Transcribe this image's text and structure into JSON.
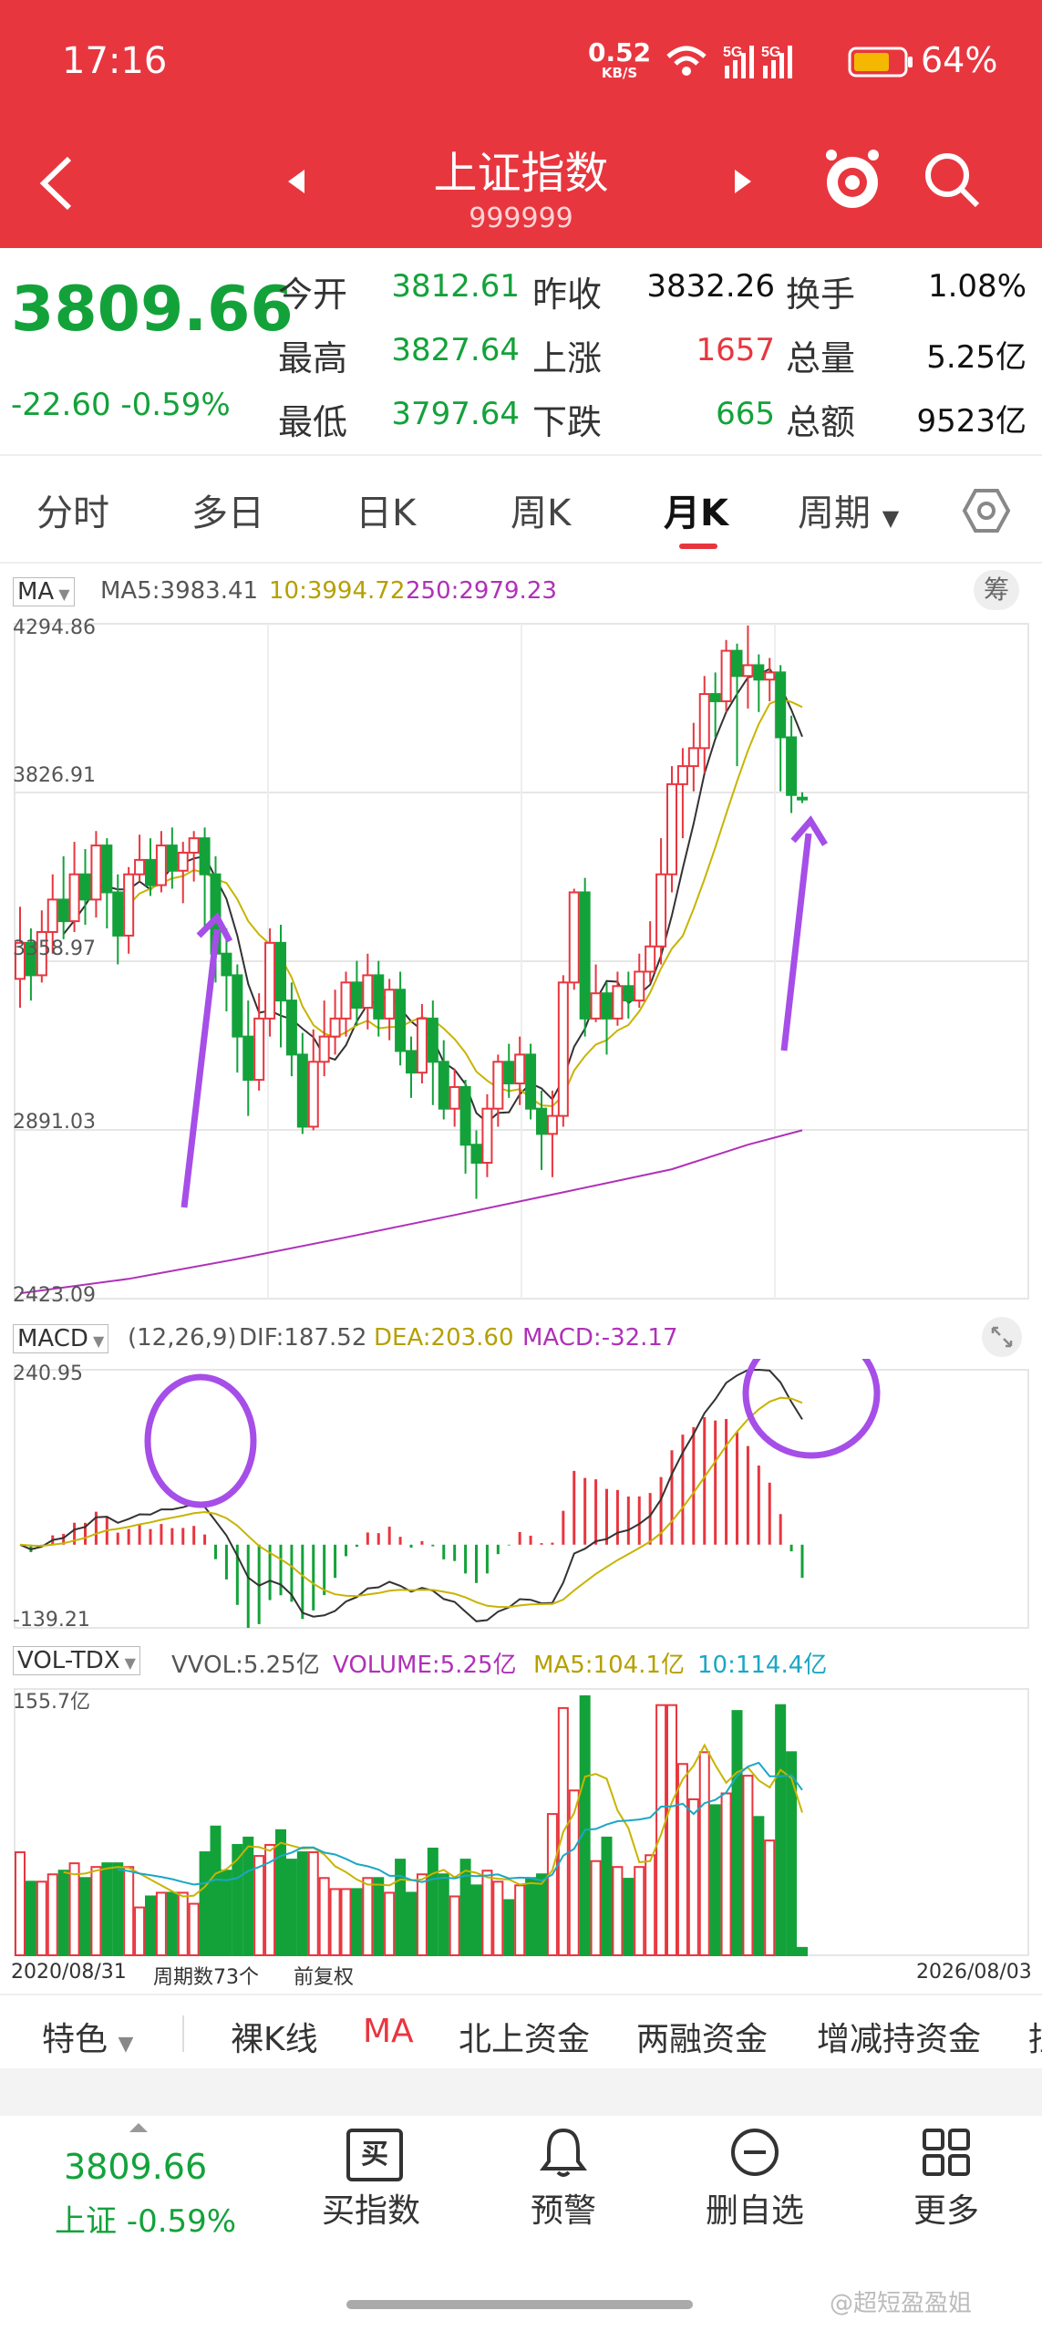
{
  "status_bar": {
    "time": "17:16",
    "net_speed": "0.52",
    "net_unit": "KB/S",
    "battery": "64%"
  },
  "header": {
    "title": "上证指数",
    "code": "999999"
  },
  "quote": {
    "price": "3809.66",
    "change": "-22.60 -0.59%",
    "labels": [
      "今开",
      "最高",
      "最低",
      "昨收",
      "上涨",
      "下跌",
      "换手",
      "总量",
      "总额"
    ],
    "values": [
      "3812.61",
      "3827.64",
      "3797.64",
      "3832.26",
      "1657",
      "665",
      "1.08%",
      "5.25亿",
      "9523亿"
    ]
  },
  "tabs": [
    "分时",
    "多日",
    "日K",
    "周K",
    "月K",
    "周期"
  ],
  "main_chart": {
    "ma_selector": "MA",
    "ma5": "MA5:3983.41",
    "ma10": "10:3994.72",
    "ma250": "250:2979.23",
    "chip_label": "筹",
    "y_labels": [
      "4294.86",
      "3826.91",
      "3358.97",
      "2891.03",
      "2423.09"
    ]
  },
  "macd_panel": {
    "selector": "MACD",
    "params": "(12,26,9)",
    "dif": "DIF:187.52",
    "dea": "DEA:203.60",
    "macd": "MACD:-32.17",
    "y_top": "240.95",
    "y_bottom": "-139.21"
  },
  "vol_panel": {
    "selector": "VOL-TDX",
    "vvol": "VVOL:5.25亿",
    "volume": "VOLUME:5.25亿",
    "ma5": "MA5:104.1亿",
    "ma10": "10:114.4亿",
    "y_top": "155.7亿"
  },
  "footer_axis": {
    "start": "2020/08/31",
    "count": "周期数73个",
    "adj": "前复权",
    "end": "2026/08/03"
  },
  "feature_bar": {
    "items": [
      "特色",
      "裸K线",
      "MA",
      "北上资金",
      "两融资金",
      "增减持资金",
      "拄"
    ]
  },
  "bottom_bar": {
    "price": "3809.66",
    "sub": "上证 -0.59%",
    "buttons": [
      "买指数",
      "预警",
      "删自选",
      "更多"
    ],
    "buy_glyph": "买"
  },
  "watermark": "@超短盈盈姐",
  "chart_data": {
    "type": "candlestick",
    "ylim": [
      2423.09,
      4294.86
    ],
    "candles": [
      [
        3310,
        3410,
        3510,
        3230
      ],
      [
        3410,
        3320,
        3450,
        3250
      ],
      [
        3320,
        3440,
        3500,
        3300
      ],
      [
        3440,
        3530,
        3600,
        3380
      ],
      [
        3530,
        3470,
        3650,
        3420
      ],
      [
        3470,
        3600,
        3690,
        3440
      ],
      [
        3600,
        3530,
        3670,
        3460
      ],
      [
        3530,
        3680,
        3720,
        3480
      ],
      [
        3680,
        3550,
        3700,
        3450
      ],
      [
        3550,
        3430,
        3600,
        3350
      ],
      [
        3430,
        3600,
        3620,
        3380
      ],
      [
        3600,
        3640,
        3710,
        3580
      ],
      [
        3640,
        3570,
        3700,
        3540
      ],
      [
        3570,
        3680,
        3720,
        3550
      ],
      [
        3680,
        3610,
        3730,
        3560
      ],
      [
        3610,
        3660,
        3690,
        3520
      ],
      [
        3660,
        3700,
        3720,
        3580
      ],
      [
        3700,
        3600,
        3730,
        3450
      ],
      [
        3600,
        3380,
        3650,
        3300
      ],
      [
        3380,
        3320,
        3450,
        3220
      ],
      [
        3320,
        3150,
        3350,
        3050
      ],
      [
        3150,
        3030,
        3250,
        2930
      ],
      [
        3030,
        3200,
        3270,
        3000
      ],
      [
        3200,
        3410,
        3450,
        3150
      ],
      [
        3410,
        3250,
        3460,
        3120
      ],
      [
        3250,
        3100,
        3300,
        3040
      ],
      [
        3100,
        2900,
        3160,
        2880
      ],
      [
        2900,
        3080,
        3170,
        2890
      ],
      [
        3080,
        3150,
        3250,
        3040
      ],
      [
        3150,
        3200,
        3280,
        3100
      ],
      [
        3200,
        3300,
        3330,
        3150
      ],
      [
        3300,
        3230,
        3360,
        3180
      ],
      [
        3230,
        3320,
        3380,
        3170
      ],
      [
        3320,
        3200,
        3360,
        3150
      ],
      [
        3200,
        3280,
        3310,
        3140
      ],
      [
        3280,
        3110,
        3330,
        3070
      ],
      [
        3110,
        3050,
        3150,
        2980
      ],
      [
        3050,
        3200,
        3240,
        3020
      ],
      [
        3200,
        3080,
        3250,
        2960
      ],
      [
        3080,
        2950,
        3140,
        2920
      ],
      [
        2950,
        3010,
        3060,
        2900
      ],
      [
        3010,
        2850,
        3030,
        2770
      ],
      [
        2850,
        2800,
        2890,
        2700
      ],
      [
        2800,
        2950,
        2990,
        2760
      ],
      [
        2950,
        3080,
        3100,
        2900
      ],
      [
        3080,
        3020,
        3130,
        2980
      ],
      [
        3020,
        3100,
        3150,
        2960
      ],
      [
        3100,
        2950,
        3130,
        2920
      ],
      [
        2950,
        2880,
        3000,
        2780
      ],
      [
        2880,
        2930,
        3000,
        2760
      ],
      [
        2930,
        3300,
        3320,
        2900
      ],
      [
        3300,
        3550,
        3560,
        3280
      ],
      [
        3550,
        3200,
        3590,
        3150
      ],
      [
        3200,
        3270,
        3350,
        3190
      ],
      [
        3270,
        3200,
        3300,
        3100
      ],
      [
        3200,
        3290,
        3330,
        3180
      ],
      [
        3290,
        3250,
        3330,
        3200
      ],
      [
        3250,
        3330,
        3380,
        3230
      ],
      [
        3330,
        3400,
        3470,
        3300
      ],
      [
        3400,
        3600,
        3700,
        3350
      ],
      [
        3600,
        3850,
        3900,
        3550
      ],
      [
        3850,
        3900,
        3950,
        3700
      ],
      [
        3900,
        3950,
        4020,
        3830
      ],
      [
        3950,
        4100,
        4150,
        3880
      ],
      [
        4100,
        4080,
        4160,
        3980
      ],
      [
        4080,
        4220,
        4250,
        4050
      ],
      [
        4220,
        4150,
        4240,
        3900
      ],
      [
        4150,
        4180,
        4290,
        4060
      ],
      [
        4180,
        4140,
        4210,
        4050
      ],
      [
        4140,
        4160,
        4200,
        4080
      ],
      [
        4160,
        3980,
        4180,
        3830
      ],
      [
        3980,
        3820,
        4040,
        3770
      ],
      [
        3812.61,
        3809.66,
        3827.64,
        3797.64
      ]
    ],
    "ma250": [
      [
        0,
        2438
      ],
      [
        10,
        2478
      ],
      [
        20,
        2533
      ],
      [
        30,
        2593
      ],
      [
        40,
        2655
      ],
      [
        50,
        2718
      ],
      [
        60,
        2782
      ],
      [
        67,
        2850
      ],
      [
        72,
        2890
      ]
    ]
  }
}
